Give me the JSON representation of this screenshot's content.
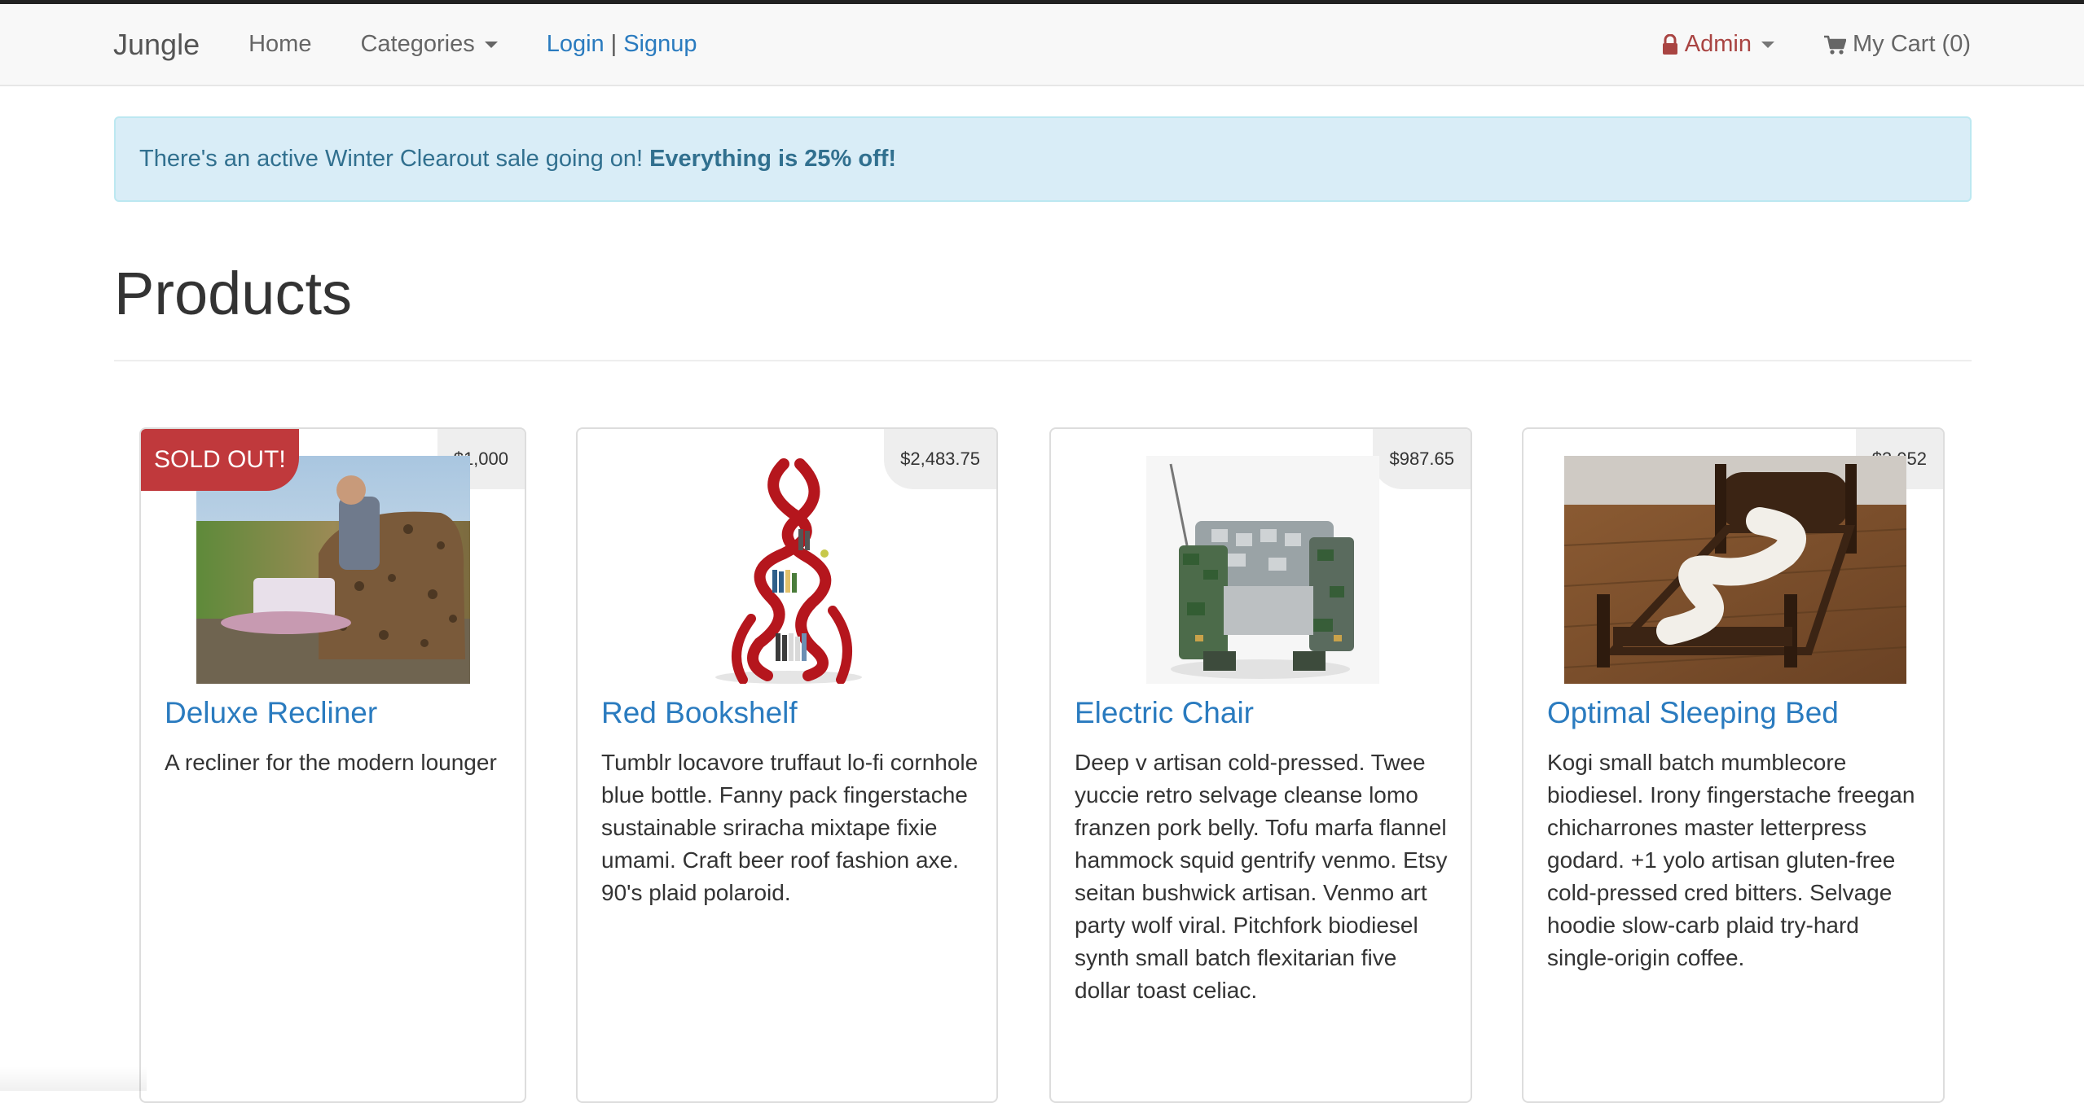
{
  "navbar": {
    "brand": "Jungle",
    "home": "Home",
    "categories": "Categories",
    "login": "Login",
    "separator": "|",
    "signup": "Signup",
    "admin": "Admin",
    "cart": "My Cart (0)"
  },
  "alert": {
    "text": "There's an active Winter Clearout sale going on!",
    "emphasis": "Everything is 25% off!"
  },
  "page": {
    "title": "Products"
  },
  "products": [
    {
      "name": "Deluxe Recliner",
      "price": "$1,000",
      "badge": "SOLD OUT!",
      "description": "A recliner for the modern lounger",
      "image_icon": "recliner-photo"
    },
    {
      "name": "Red Bookshelf",
      "price": "$2,483.75",
      "description": "Tumblr locavore truffaut lo-fi cornhole blue bottle. Fanny pack fingerstache sustainable sriracha mixtape fixie umami. Craft beer roof fashion axe. 90's plaid polaroid.",
      "image_icon": "bookshelf-photo"
    },
    {
      "name": "Electric Chair",
      "price": "$987.65",
      "description": "Deep v artisan cold-pressed. Twee yuccie retro selvage cleanse lomo franzen pork belly. Tofu marfa flannel hammock squid gentrify venmo. Etsy seitan bushwick artisan. Venmo art party wolf viral. Pitchfork biodiesel synth small batch flexitarian five dollar toast celiac.",
      "image_icon": "chair-photo"
    },
    {
      "name": "Optimal Sleeping Bed",
      "price": "$3,052",
      "description": "Kogi small batch mumblecore biodiesel. Irony fingerstache freegan chicharrones master letterpress godard. +1 yolo artisan gluten-free cold-pressed cred bitters. Selvage hoodie slow-carb plaid try-hard single-origin coffee.",
      "image_icon": "bed-photo"
    }
  ],
  "colors": {
    "link": "#2a7bbf",
    "alert_bg": "#d9edf7",
    "alert_text": "#31708f",
    "sold_out": "#c0393c",
    "admin": "#a94442"
  }
}
